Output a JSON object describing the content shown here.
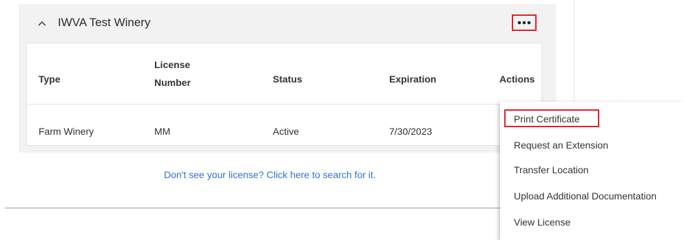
{
  "panel": {
    "winery_name": "IWVA Test Winery",
    "more_icon": "ellipsis-icon",
    "collapse_icon": "chevron-up-icon"
  },
  "table": {
    "headers": {
      "type": "Type",
      "license_number_line1": "License",
      "license_number_line2": "Number",
      "status": "Status",
      "expiration": "Expiration",
      "actions": "Actions"
    },
    "rows": [
      {
        "type": "Farm Winery",
        "license_number": "MM",
        "status": "Active",
        "expiration": "7/30/2023"
      }
    ]
  },
  "search_link": "Don't see your license? Click here to search for it.",
  "actions_menu": {
    "items": [
      "Print Certificate",
      "Request an Extension",
      "Transfer Location",
      "Upload Additional Documentation",
      "View License"
    ]
  },
  "colors": {
    "highlight": "#e0202a",
    "link": "#2f74c9",
    "panel_bg": "#f2f2f2"
  }
}
